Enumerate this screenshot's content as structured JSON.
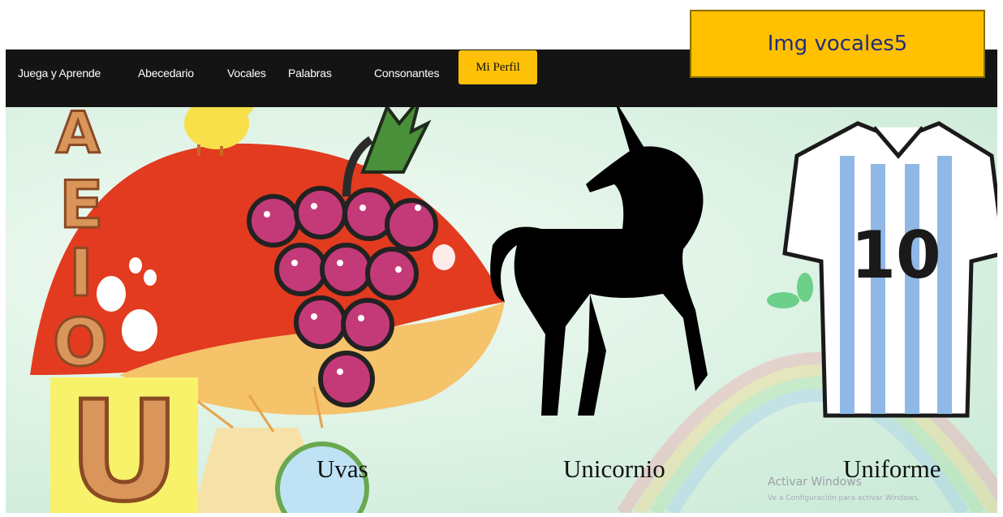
{
  "annotation": {
    "label": "Img vocales5"
  },
  "nav": {
    "items": [
      {
        "label": "Juega y Aprende"
      },
      {
        "label": "Abecedario"
      },
      {
        "label": "Vocales"
      },
      {
        "label": "Palabras"
      },
      {
        "label": "Consonantes"
      }
    ],
    "active_label": "Mi Perfil",
    "active_color": "#ffc107",
    "background": "#141414"
  },
  "cards": [
    {
      "caption": "Uvas"
    },
    {
      "caption": "Unicornio"
    },
    {
      "caption": "Uniforme"
    }
  ],
  "letter_image": {
    "letter": "U",
    "background": "#f7f26a",
    "stacked_letters": "AEIO"
  },
  "jersey": {
    "number": "10"
  },
  "watermark": {
    "title": "Activar Windows",
    "subtitle": "Ve a Configuración para activar Windows."
  }
}
